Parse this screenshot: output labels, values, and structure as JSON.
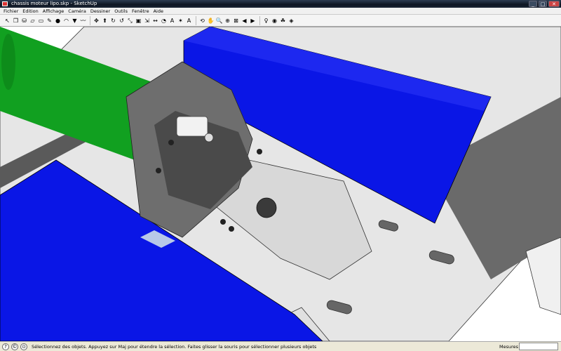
{
  "window": {
    "title": "chassis moteur lipo.skp - SketchUp",
    "controls": {
      "minimize": "_",
      "maximize": "□",
      "close": "✕"
    }
  },
  "menu": [
    "Fichier",
    "Edition",
    "Affichage",
    "Caméra",
    "Dessiner",
    "Outils",
    "Fenêtre",
    "Aide"
  ],
  "toolbar": {
    "tools": [
      {
        "name": "select-tool-icon",
        "glyph": "↖"
      },
      {
        "name": "make-component-icon",
        "glyph": "❒"
      },
      {
        "name": "paint-bucket-icon",
        "glyph": "⛁"
      },
      {
        "name": "eraser-icon",
        "glyph": "▱"
      },
      {
        "name": "rectangle-icon",
        "glyph": "▭"
      },
      {
        "name": "line-icon",
        "glyph": "✎"
      },
      {
        "name": "circle-icon",
        "glyph": "●"
      },
      {
        "name": "arc-icon",
        "glyph": "◠"
      },
      {
        "name": "polygon-icon",
        "glyph": "▼"
      },
      {
        "name": "freehand-icon",
        "glyph": "〰"
      },
      {
        "name": "move-icon",
        "glyph": "✥"
      },
      {
        "name": "push-pull-icon",
        "glyph": "⬆"
      },
      {
        "name": "rotate-icon",
        "glyph": "↻"
      },
      {
        "name": "follow-me-icon",
        "glyph": "↺"
      },
      {
        "name": "scale-icon",
        "glyph": "⤡"
      },
      {
        "name": "offset-icon",
        "glyph": "▣"
      },
      {
        "name": "tape-measure-icon",
        "glyph": "⇲"
      },
      {
        "name": "dimension-icon",
        "glyph": "↔"
      },
      {
        "name": "protractor-icon",
        "glyph": "◔"
      },
      {
        "name": "text-icon",
        "glyph": "A"
      },
      {
        "name": "axes-icon",
        "glyph": "✶"
      },
      {
        "name": "3d-text-icon",
        "glyph": "A"
      },
      {
        "name": "orbit-icon",
        "glyph": "⟲"
      },
      {
        "name": "pan-icon",
        "glyph": "✋"
      },
      {
        "name": "zoom-icon",
        "glyph": "🔍"
      },
      {
        "name": "zoom-window-icon",
        "glyph": "⊕"
      },
      {
        "name": "zoom-extents-icon",
        "glyph": "⊠"
      },
      {
        "name": "previous-view-icon",
        "glyph": "◀"
      },
      {
        "name": "next-view-icon",
        "glyph": "▶"
      },
      {
        "name": "position-camera-icon",
        "glyph": "♀"
      },
      {
        "name": "look-around-icon",
        "glyph": "◉"
      },
      {
        "name": "walk-icon",
        "glyph": "☘"
      },
      {
        "name": "section-plane-icon",
        "glyph": "◈"
      }
    ]
  },
  "status": {
    "message": "Sélectionnez des objets. Appuyez sur Maj pour étendre la sélection. Faites glisser la souris pour sélectionner plusieurs objets",
    "measures_label": "Mesures",
    "measures_value": ""
  },
  "colors": {
    "battery_green": "#11a020",
    "battery_blue": "#0a16e6",
    "motor_mount_gray": "#6e6e6e",
    "plate_gray": "#e4e4e4",
    "rail_gray": "#6a6a6a"
  }
}
